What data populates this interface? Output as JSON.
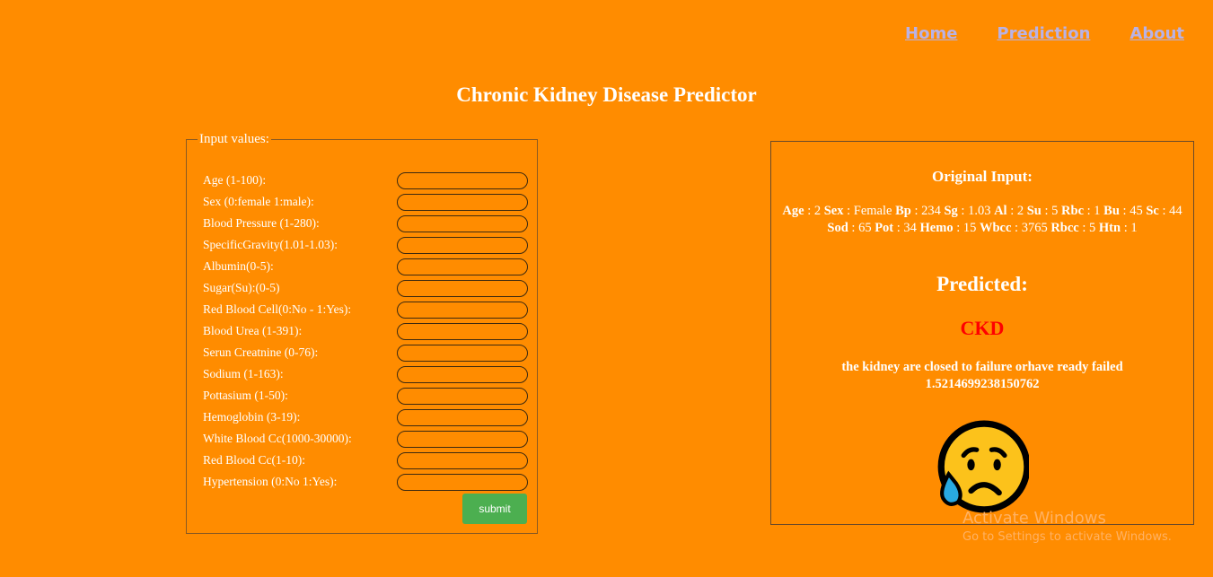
{
  "nav": {
    "home": "Home",
    "prediction": "Prediction",
    "about": "About"
  },
  "page_title": "Chronic Kidney Disease Predictor",
  "form": {
    "legend": "Input values:",
    "fields": [
      {
        "label": "Age (1-100):",
        "value": ""
      },
      {
        "label": "Sex (0:female 1:male):",
        "value": ""
      },
      {
        "label": "Blood Pressure (1-280):",
        "value": ""
      },
      {
        "label": "SpecificGravity(1.01-1.03):",
        "value": ""
      },
      {
        "label": "Albumin(0-5):",
        "value": ""
      },
      {
        "label": "Sugar(Su):(0-5)",
        "value": ""
      },
      {
        "label": "Red Blood Cell(0:No - 1:Yes):",
        "value": ""
      },
      {
        "label": "Blood Urea (1-391):",
        "value": ""
      },
      {
        "label": "Serun Creatnine (0-76):",
        "value": ""
      },
      {
        "label": "Sodium (1-163):",
        "value": ""
      },
      {
        "label": "Pottasium (1-50):",
        "value": ""
      },
      {
        "label": "Hemoglobin (3-19):",
        "value": ""
      },
      {
        "label": "White Blood Cc(1000-30000):",
        "value": ""
      },
      {
        "label": "Red Blood Cc(1-10):",
        "value": ""
      },
      {
        "label": "Hypertension (0:No 1:Yes):",
        "value": ""
      }
    ],
    "submit_label": "submit"
  },
  "result": {
    "original_heading": "Original Input:",
    "original_values": [
      {
        "key": "Age",
        "value": "2"
      },
      {
        "key": "Sex",
        "value": "Female"
      },
      {
        "key": "Bp",
        "value": "234"
      },
      {
        "key": "Sg",
        "value": "1.03"
      },
      {
        "key": "Al",
        "value": "2"
      },
      {
        "key": "Su",
        "value": "5"
      },
      {
        "key": "Rbc",
        "value": "1"
      },
      {
        "key": "Bu",
        "value": "45"
      },
      {
        "key": "Sc",
        "value": "44"
      },
      {
        "key": "Sod",
        "value": "65"
      },
      {
        "key": "Pot",
        "value": "34"
      },
      {
        "key": "Hemo",
        "value": "15"
      },
      {
        "key": "Wbcc",
        "value": "3765"
      },
      {
        "key": "Rbcc",
        "value": "5"
      },
      {
        "key": "Htn",
        "value": "1"
      }
    ],
    "predicted_heading": "Predicted:",
    "predicted_value": "CKD",
    "predicted_color": "#ff0000",
    "message": "the kidney are closed to failure orhave ready failed",
    "score": "1.5214699238150762",
    "emoji": "sad-tear-face-icon"
  },
  "watermark": {
    "line1": "Activate Windows",
    "line2": "Go to Settings to activate Windows."
  },
  "colors": {
    "background": "#FF8C00",
    "submit": "#4CAF50",
    "nav_link": "#b9b2e6"
  }
}
